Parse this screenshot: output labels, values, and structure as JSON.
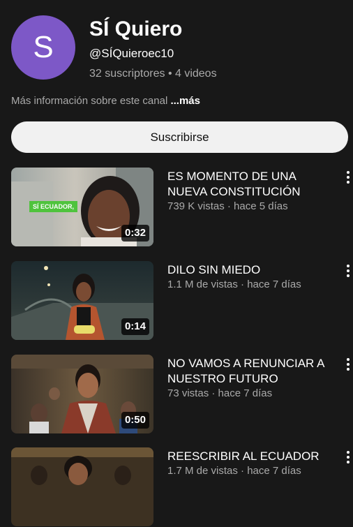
{
  "channel": {
    "avatar_letter": "S",
    "avatar_color": "#7d58c7",
    "name": "SÍ Quiero",
    "handle": "@SÍQuieroec10",
    "stats": "32 suscriptores • 4 videos",
    "about": "Más información sobre este canal",
    "about_more": "...más"
  },
  "subscribe_label": "Suscribirse",
  "videos": [
    {
      "title": "ES MOMENTO DE UNA NUEVA CONSTITUCIÓN",
      "sub": "739 K vistas · hace 5 días",
      "duration": "0:32",
      "tag": "SÍ ECUADOR,"
    },
    {
      "title": "DILO SIN MIEDO",
      "sub": "1.1 M de vistas · hace 7 días",
      "duration": "0:14"
    },
    {
      "title": "NO VAMOS A RENUNCIAR A NUESTRO FUTURO",
      "sub": "73 vistas · hace 7 días",
      "duration": "0:50"
    },
    {
      "title": "REESCRIBIR AL ECUADOR",
      "sub": "1.7 M de vistas · hace 7 días"
    }
  ]
}
